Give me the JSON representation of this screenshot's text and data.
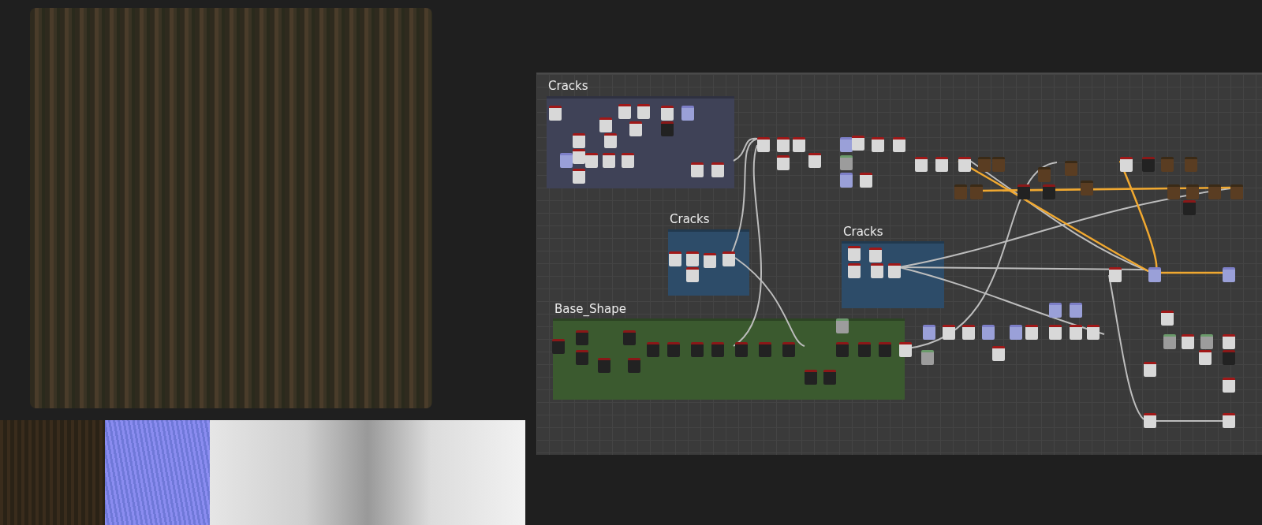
{
  "graph": {
    "frames": [
      {
        "title": "Cracks"
      },
      {
        "title": "Cracks"
      },
      {
        "title": "Cracks"
      },
      {
        "title": "Base_Shape"
      }
    ]
  }
}
